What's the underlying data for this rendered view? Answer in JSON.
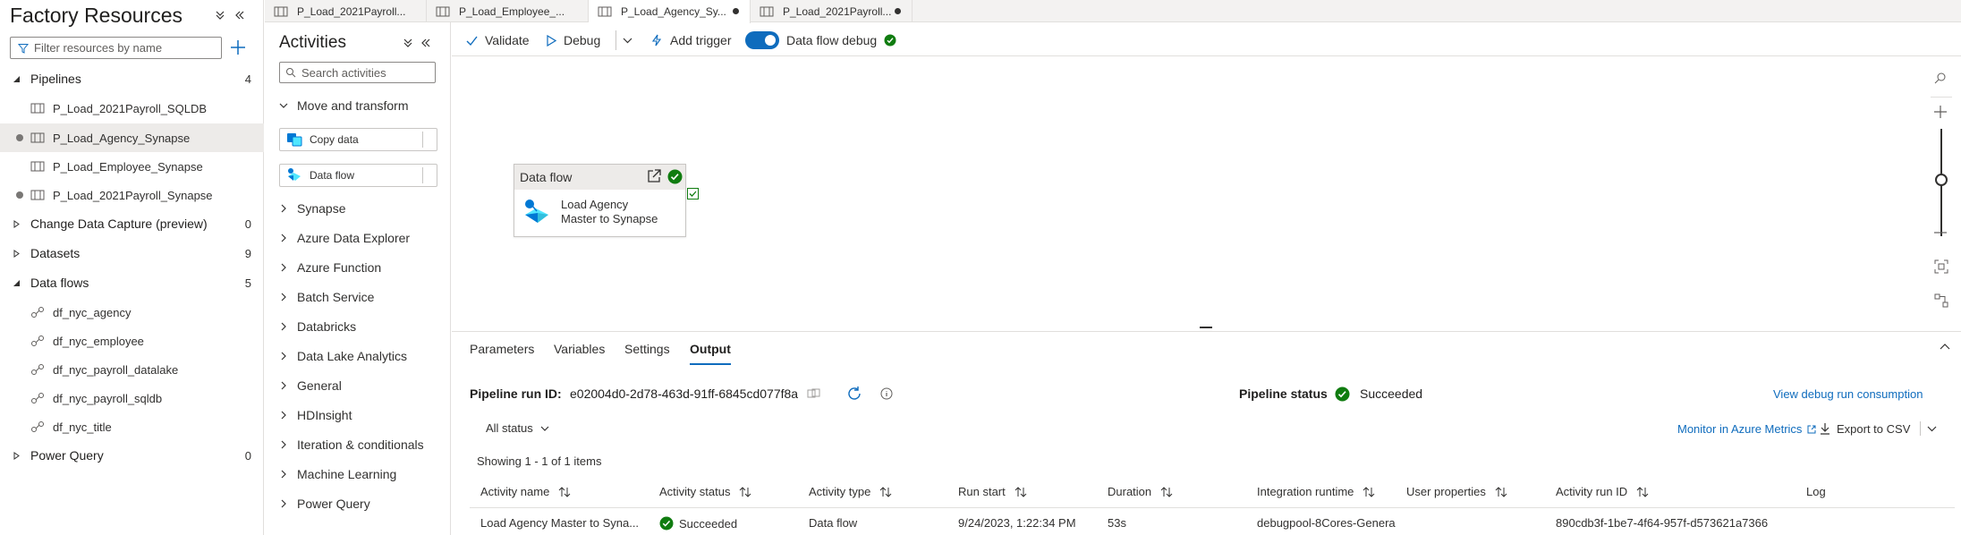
{
  "factory": {
    "title": "Factory Resources",
    "filter_placeholder": "Filter resources by name",
    "sections": [
      {
        "label": "Pipelines",
        "count": "4",
        "expanded": true
      },
      {
        "label": "Change Data Capture (preview)",
        "count": "0",
        "expanded": false
      },
      {
        "label": "Datasets",
        "count": "9",
        "expanded": false
      },
      {
        "label": "Data flows",
        "count": "5",
        "expanded": true
      },
      {
        "label": "Power Query",
        "count": "0",
        "expanded": false
      }
    ],
    "pipelines": [
      "P_Load_2021Payroll_SQLDB",
      "P_Load_Agency_Synapse",
      "P_Load_Employee_Synapse",
      "P_Load_2021Payroll_Synapse"
    ],
    "dataflows": [
      "df_nyc_agency",
      "df_nyc_employee",
      "df_nyc_payroll_datalake",
      "df_nyc_payroll_sqldb",
      "df_nyc_title"
    ]
  },
  "tabs": [
    "P_Load_2021Payroll...",
    "P_Load_Employee_...",
    "P_Load_Agency_Sy...",
    "P_Load_2021Payroll..."
  ],
  "activities": {
    "title": "Activities",
    "search_placeholder": "Search activities",
    "move_transform": "Move and transform",
    "copy_data": "Copy data",
    "data_flow": "Data flow",
    "categories": [
      "Synapse",
      "Azure Data Explorer",
      "Azure Function",
      "Batch Service",
      "Databricks",
      "Data Lake Analytics",
      "General",
      "HDInsight",
      "Iteration & conditionals",
      "Machine Learning",
      "Power Query"
    ]
  },
  "toolbar": {
    "validate": "Validate",
    "debug": "Debug",
    "add_trigger": "Add trigger",
    "dataflow_debug": "Data flow debug"
  },
  "node": {
    "type": "Data flow",
    "name_line1": "Load Agency",
    "name_line2": "Master to Synapse"
  },
  "bottom": {
    "tabs": [
      "Parameters",
      "Variables",
      "Settings",
      "Output"
    ],
    "run_id_label": "Pipeline run ID:",
    "run_id": "e02004d0-2d78-463d-91ff-6845cd077f8a",
    "status_label": "Pipeline status",
    "status": "Succeeded",
    "debug_consumption": "View debug run consumption",
    "filter": "All status",
    "monitor": "Monitor in Azure Metrics",
    "export": "Export to CSV",
    "showing": "Showing 1 - 1 of 1 items",
    "columns": [
      "Activity name",
      "Activity status",
      "Activity type",
      "Run start",
      "Duration",
      "Integration runtime",
      "User properties",
      "Activity run ID",
      "Log"
    ],
    "row": {
      "name": "Load Agency Master to Syna...",
      "status": "Succeeded",
      "type": "Data flow",
      "run_start": "9/24/2023, 1:22:34 PM",
      "duration": "53s",
      "runtime": "debugpool-8Cores-Genera",
      "run_id": "890cdb3f-1be7-4f64-957f-d573621a7366"
    }
  },
  "colors": {
    "accent": "#0f6cbd",
    "success": "#107c10"
  }
}
